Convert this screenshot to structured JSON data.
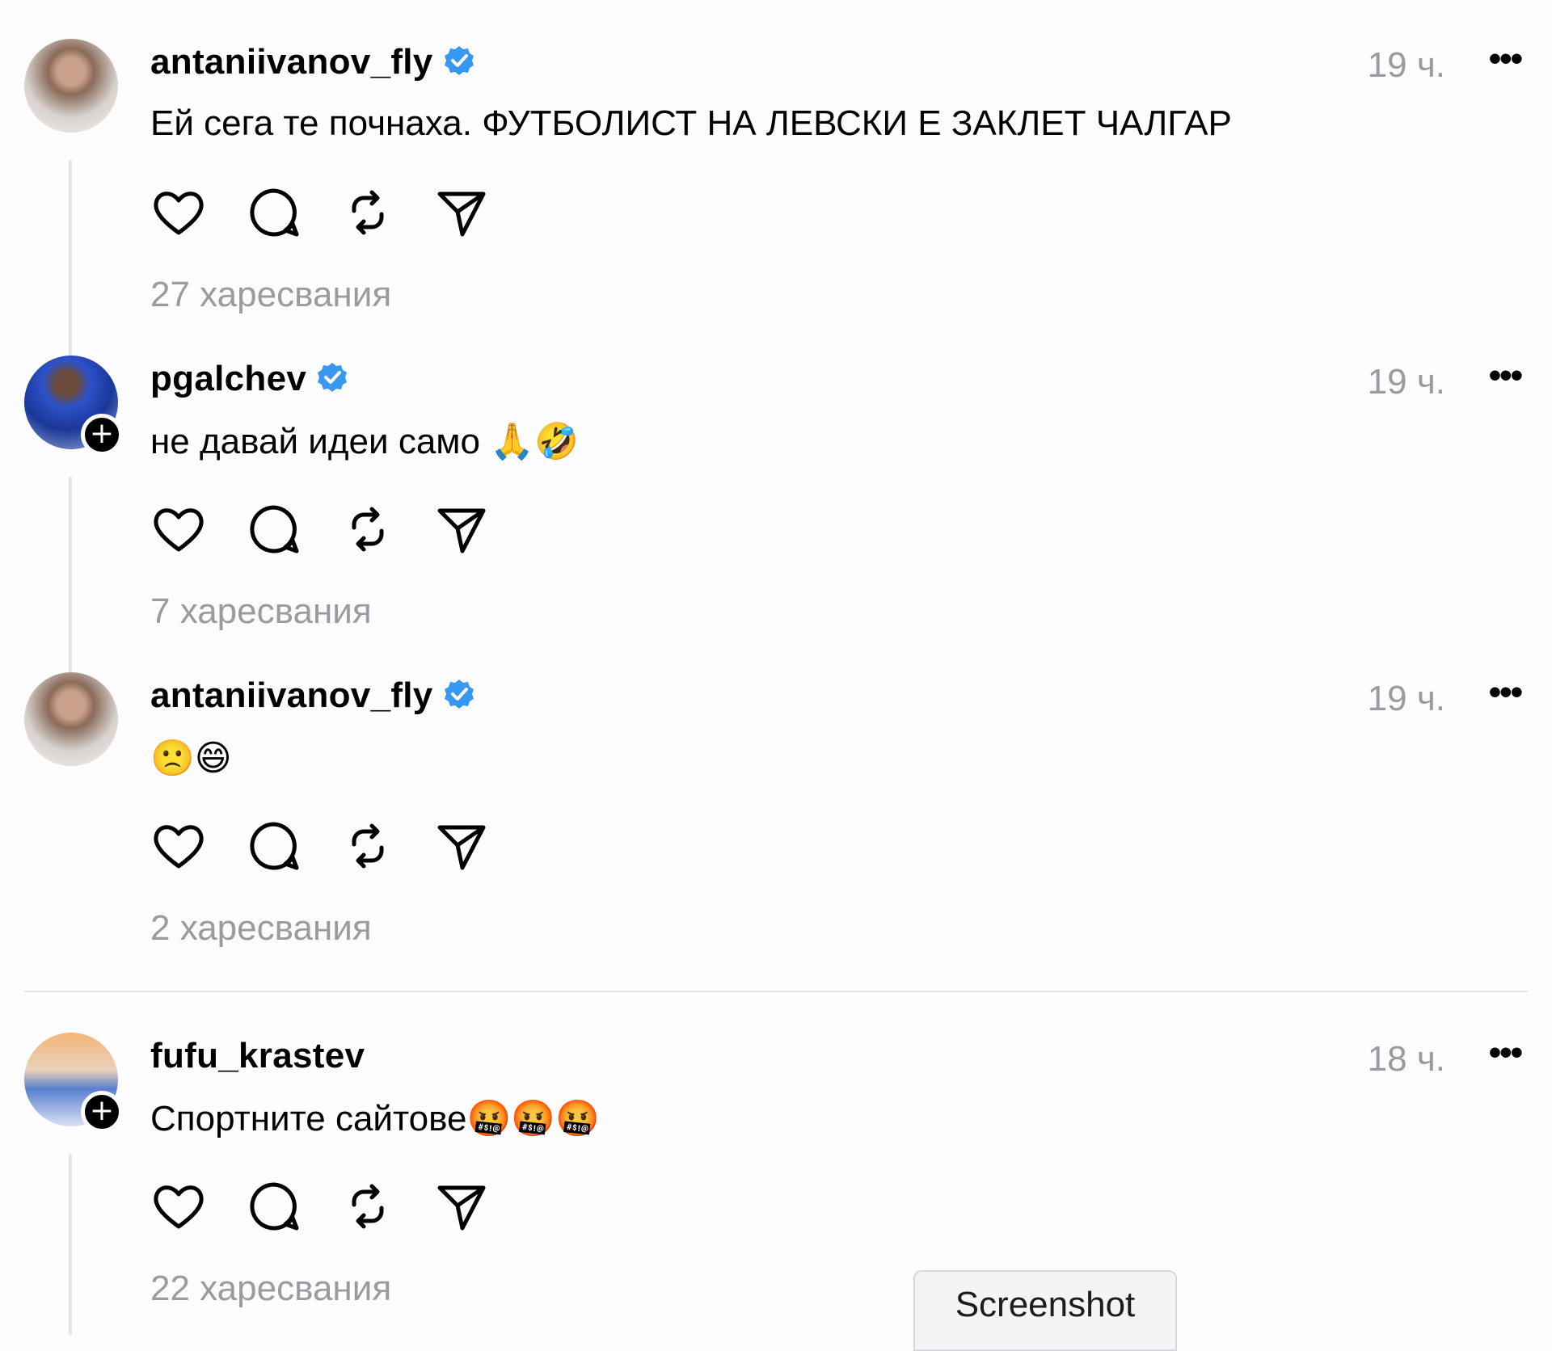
{
  "posts": [
    {
      "username": "antaniivanov_fly",
      "verified": true,
      "timestamp": "19 ч.",
      "text": "Ей сега те почнаха. ФУТБОЛИСТ НА ЛЕВСКИ Е ЗАКЛЕТ ЧАЛГАР",
      "likes": "27 харесвания",
      "avatar_icon": "avatar-antaniivanov_fly"
    },
    {
      "username": "pgalchev",
      "verified": true,
      "timestamp": "19 ч.",
      "text": "не давай идеи само 🙏🤣",
      "likes": "7 харесвания",
      "avatar_icon": "avatar-pgalchev",
      "follow_badge": "+"
    },
    {
      "username": "antaniivanov_fly",
      "verified": true,
      "timestamp": "19 ч.",
      "text": "🙁😄",
      "likes": "2 харесвания",
      "avatar_icon": "avatar-antaniivanov_fly"
    },
    {
      "username": "fufu_krastev",
      "verified": false,
      "timestamp": "18 ч.",
      "text": "Спортните сайтове🤬🤬🤬",
      "likes": "22 харесвания",
      "avatar_icon": "avatar-fufu_krastev",
      "follow_badge": "+"
    }
  ],
  "more_label": "•••",
  "action_icons": [
    "heart-icon",
    "comment-icon",
    "repost-icon",
    "share-icon"
  ],
  "screenshot_button": "Screenshot",
  "colors": {
    "verified": "#3897f0",
    "muted": "#9a9a9f",
    "thread_line": "#e6e6e9"
  }
}
